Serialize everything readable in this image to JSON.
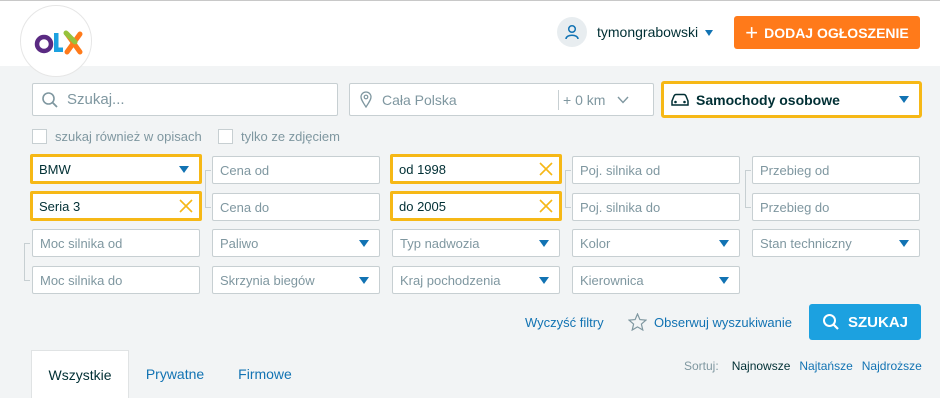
{
  "header": {
    "logo_text": "OLX",
    "username": "tymongrabowski",
    "add_button_label": "DODAJ OGŁOSZENIE"
  },
  "search": {
    "query_placeholder": "Szukaj...",
    "location_value": "Cała Polska",
    "radius_value": "+ 0 km",
    "category_value": "Samochody osobowe",
    "also_descriptions_label": "szukaj również w opisach",
    "photo_only_label": "tylko ze zdjęciem"
  },
  "filters": {
    "make": "BMW",
    "model": "Seria 3",
    "price_from": "Cena od",
    "price_to": "Cena do",
    "year_from": "od 1998",
    "year_to": "do 2005",
    "engine_from": "Poj. silnika od",
    "engine_to": "Poj. silnika do",
    "mileage_from": "Przebieg od",
    "mileage_to": "Przebieg do",
    "power_from": "Moc silnika od",
    "power_to": "Moc silnika do",
    "fuel": "Paliwo",
    "gearbox": "Skrzynia biegów",
    "body_type": "Typ nadwozia",
    "origin_country": "Kraj pochodzenia",
    "color": "Kolor",
    "steering": "Kierownica",
    "condition": "Stan techniczny"
  },
  "actions": {
    "clear_filters": "Wyczyść filtry",
    "watch_search": "Obserwuj wyszukiwanie",
    "search_button": "SZUKAJ"
  },
  "tabs": [
    "Wszystkie",
    "Prywatne",
    "Firmowe"
  ],
  "sort": {
    "label": "Sortuj:",
    "options": [
      "Najnowsze",
      "Najtańsze",
      "Najdroższe"
    ]
  },
  "colors": {
    "accent_orange": "#ff7a1a",
    "highlight_yellow": "#f6b816",
    "link_blue": "#1273b3",
    "search_blue": "#1ca1e0"
  }
}
